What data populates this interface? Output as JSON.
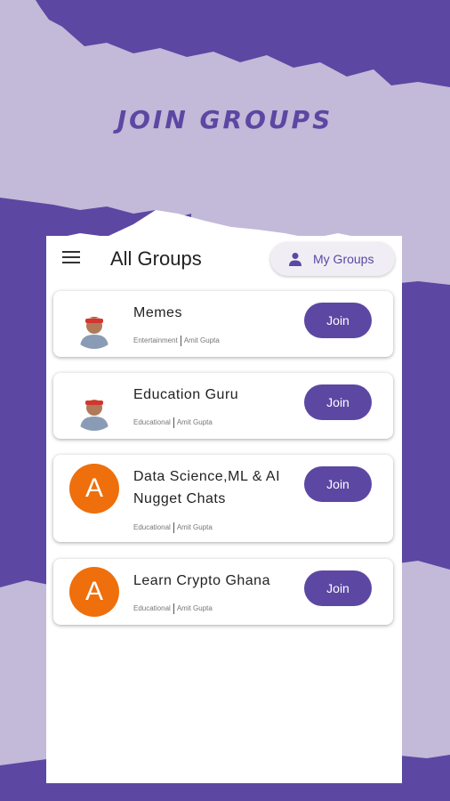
{
  "promo": {
    "title": "JOIN GROUPS"
  },
  "header": {
    "title": "All Groups",
    "my_groups_label": "My Groups"
  },
  "groups": [
    {
      "name": "Memes",
      "category": "Entertainment",
      "owner": "Amit Gupta",
      "avatar": "person-photo",
      "join_label": "Join"
    },
    {
      "name": "Education Guru",
      "category": "Educational",
      "owner": "Amit Gupta",
      "avatar": "person-photo",
      "join_label": "Join"
    },
    {
      "name": "Data Science,ML & AI Nugget Chats",
      "category": "Educational",
      "owner": "Amit Gupta",
      "avatar_letter": "A",
      "join_label": "Join"
    },
    {
      "name": "Learn Crypto Ghana",
      "category": "Educational",
      "owner": "Amit Gupta",
      "avatar_letter": "A",
      "join_label": "Join"
    }
  ],
  "colors": {
    "accent": "#5c47a3",
    "lavender": "#c3b9d8",
    "avatar_orange": "#ee6f0c"
  }
}
